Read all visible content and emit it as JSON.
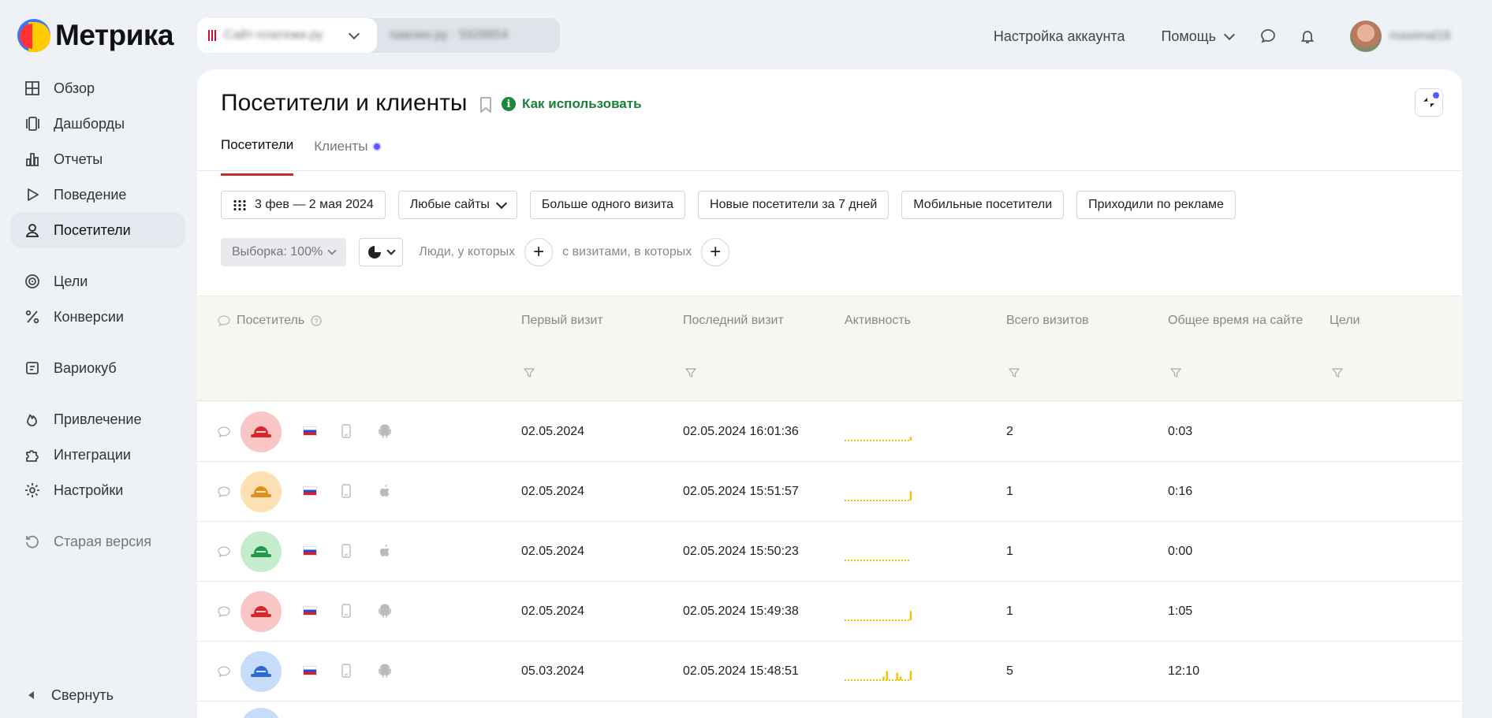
{
  "app": {
    "logo_text": "Метрика",
    "counter_name": "Сайт-платежи.ру",
    "counter_id": "павлин.ру · 5928854"
  },
  "header": {
    "account_settings": "Настройка аккаунта",
    "help": "Помощь",
    "user_name": "maximal18"
  },
  "sidebar": {
    "items": [
      {
        "label": "Обзор",
        "icon": "grid-icon"
      },
      {
        "label": "Дашборды",
        "icon": "dashboards-icon"
      },
      {
        "label": "Отчеты",
        "icon": "bar-chart-icon"
      },
      {
        "label": "Поведение",
        "icon": "play-icon"
      },
      {
        "label": "Посетители",
        "icon": "user-icon",
        "active": true
      },
      {
        "label": "Цели",
        "icon": "target-icon"
      },
      {
        "label": "Конверсии",
        "icon": "percent-icon"
      },
      {
        "label": "Вариокуб",
        "icon": "variocube-icon"
      },
      {
        "label": "Привлечение",
        "icon": "flame-icon"
      },
      {
        "label": "Интеграции",
        "icon": "puzzle-icon"
      },
      {
        "label": "Настройки",
        "icon": "gear-icon"
      },
      {
        "label": "Старая версия",
        "icon": "history-icon"
      }
    ],
    "collapse": "Свернуть"
  },
  "page": {
    "title": "Посетители и клиенты",
    "how_to": "Как использовать",
    "tabs": [
      {
        "label": "Посетители"
      },
      {
        "label": "Клиенты"
      }
    ]
  },
  "filters": {
    "date_range": "3 фев — 2 мая 2024",
    "sites": "Любые сайты",
    "presets": [
      "Больше одного визита",
      "Новые посетители за 7 дней",
      "Мобильные посетители",
      "Приходили по рекламе"
    ],
    "sample": "Выборка: 100%",
    "people_label": "Люди, у которых",
    "visits_label": "с визитами, в которых"
  },
  "table": {
    "columns": [
      "Посетитель",
      "Первый визит",
      "Последний визит",
      "Активность",
      "Всего визитов",
      "Общее время на сайте",
      "Цели"
    ],
    "rows": [
      {
        "avatar_color": "#f9c5c5",
        "hat_color": "#d8262c",
        "os": "android",
        "first_visit": "02.05.2024",
        "last_visit": "02.05.2024 16:01:36",
        "activity": [
          0,
          0,
          0,
          0,
          0,
          0,
          0,
          0,
          0,
          0,
          0,
          0,
          0,
          0,
          0,
          0,
          0,
          0,
          0,
          2
        ],
        "visits": "2",
        "time": "0:03"
      },
      {
        "avatar_color": "#fde0b3",
        "hat_color": "#e0901a",
        "os": "apple",
        "first_visit": "02.05.2024",
        "last_visit": "02.05.2024 15:51:57",
        "activity": [
          0,
          0,
          0,
          0,
          0,
          0,
          0,
          0,
          0,
          0,
          0,
          0,
          0,
          0,
          0,
          0,
          0,
          0,
          0,
          5
        ],
        "visits": "1",
        "time": "0:16"
      },
      {
        "avatar_color": "#c6ecce",
        "hat_color": "#1f9a48",
        "os": "apple",
        "first_visit": "02.05.2024",
        "last_visit": "02.05.2024 15:50:23",
        "activity": [
          0,
          0,
          0,
          0,
          0,
          0,
          0,
          0,
          0,
          0,
          0,
          0,
          0,
          0,
          0,
          0,
          0,
          0,
          0,
          0
        ],
        "visits": "1",
        "time": "0:00"
      },
      {
        "avatar_color": "#f9c5c5",
        "hat_color": "#d8262c",
        "os": "android",
        "first_visit": "02.05.2024",
        "last_visit": "02.05.2024 15:49:38",
        "activity": [
          0,
          0,
          0,
          0,
          0,
          0,
          0,
          0,
          0,
          0,
          0,
          0,
          0,
          0,
          0,
          0,
          0,
          0,
          0,
          5
        ],
        "visits": "1",
        "time": "1:05"
      },
      {
        "avatar_color": "#c7dcfb",
        "hat_color": "#2a6bd6",
        "os": "android",
        "first_visit": "05.03.2024",
        "last_visit": "02.05.2024 15:48:51",
        "activity": [
          0,
          0,
          0,
          0,
          0,
          0,
          0,
          0,
          0,
          0,
          0,
          2,
          5,
          0,
          0,
          4,
          2,
          0,
          0,
          5
        ],
        "visits": "5",
        "time": "12:10"
      }
    ]
  },
  "colors": {
    "accent_red": "#c8312a",
    "link_green": "#1a7f37",
    "sparkline": "#f2c200",
    "bg": "#eef1f6"
  }
}
